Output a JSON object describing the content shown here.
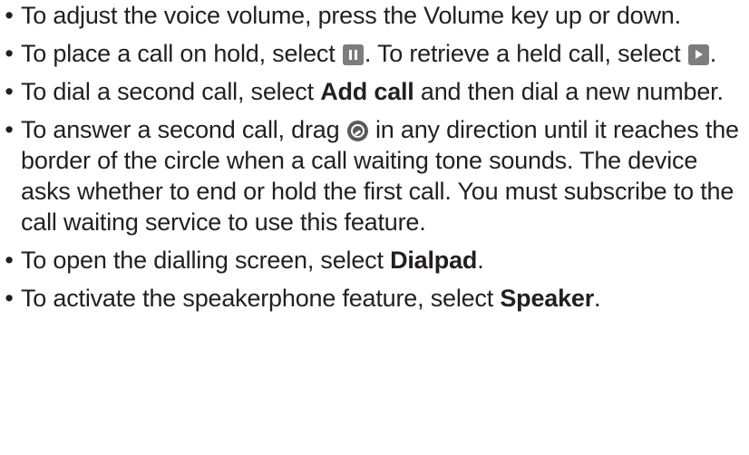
{
  "bullet_char": "•",
  "items": [
    {
      "text": "To adjust the voice volume, press the Volume key up or down."
    },
    {
      "text_a": "To place a call on hold, select ",
      "icon_a": "pause-icon",
      "text_b": ". To retrieve a held call, select ",
      "icon_b": "play-icon",
      "text_c": "."
    },
    {
      "text_a": "To dial a second call, select ",
      "bold": "Add call",
      "text_b": " and then dial a new number."
    },
    {
      "text_a": "To answer a second call, drag ",
      "icon": "answer-call-icon",
      "text_b": " in any direction until it reaches the border of the circle when a call waiting tone sounds. The device asks whether to end or hold the first call. You must subscribe to the call waiting service to use this feature."
    },
    {
      "text_a": "To open the dialling screen, select ",
      "bold": "Dialpad",
      "text_b": "."
    },
    {
      "text_a": "To activate the speakerphone feature, select ",
      "bold": "Speaker",
      "text_b": "."
    }
  ],
  "colors": {
    "text": "#231f20",
    "icon_gray": "#7d7d7d",
    "icon_dark": "#5a5a5a"
  }
}
